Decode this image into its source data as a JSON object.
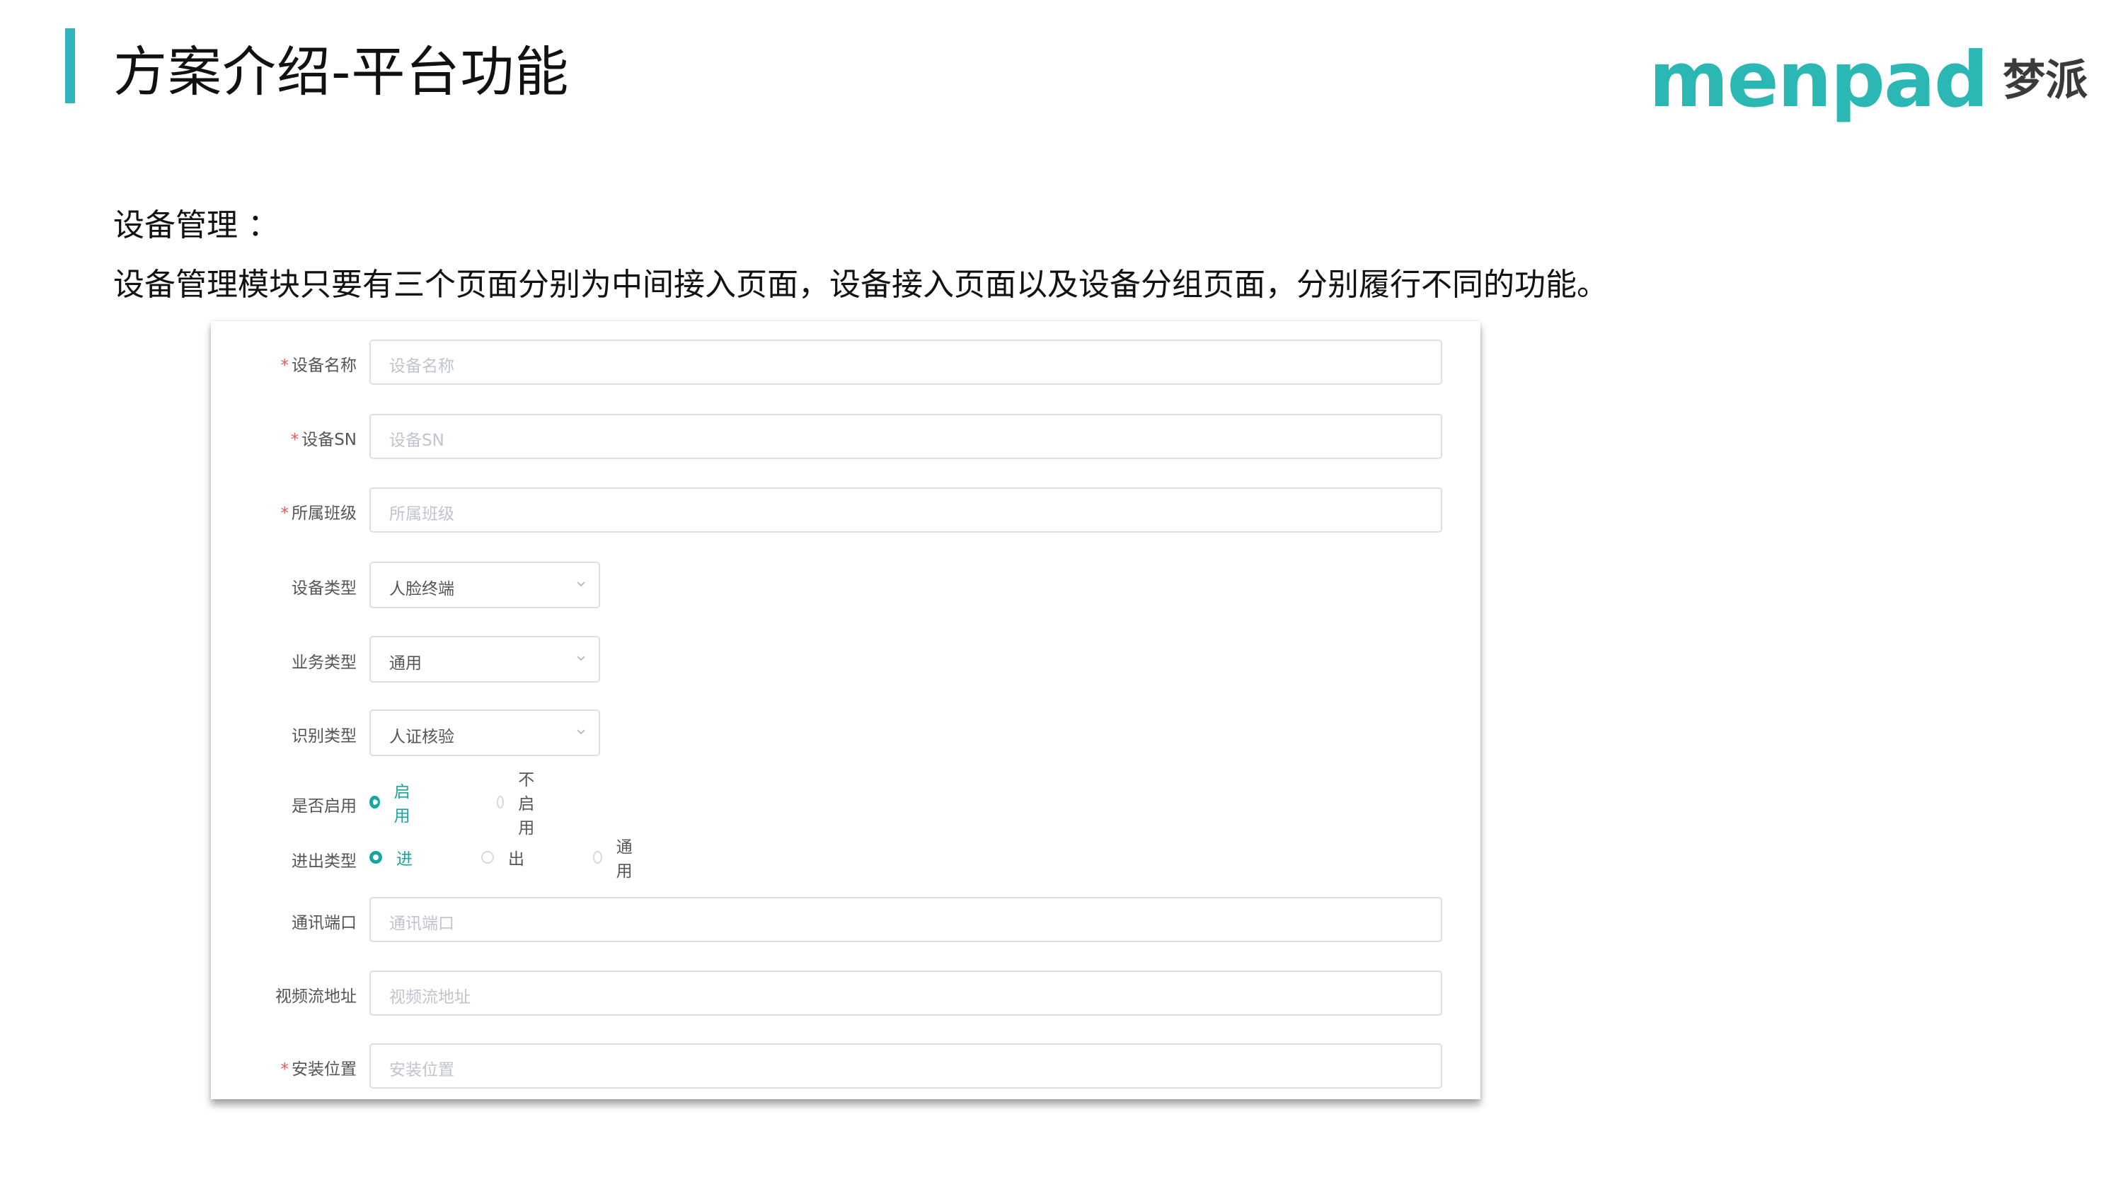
{
  "header": {
    "title": "方案介绍-平台功能",
    "logo_text": "menpad",
    "logo_cn": "梦派",
    "accent_color": "#2fb4bd"
  },
  "section": {
    "label": "设备管理 ：",
    "description": "设备管理模块只要有三个页面分别为中间接入页面，设备接入页面以及设备分组页面，分别履行不同的功能。"
  },
  "form": {
    "device_name": {
      "label": "设备名称",
      "required": true,
      "placeholder": "设备名称"
    },
    "device_sn": {
      "label": "设备SN",
      "required": true,
      "placeholder": "设备SN"
    },
    "class": {
      "label": "所属班级",
      "required": true,
      "placeholder": "所属班级"
    },
    "device_type": {
      "label": "设备类型",
      "value": "人脸终端"
    },
    "business_type": {
      "label": "业务类型",
      "value": "通用"
    },
    "recognition_type": {
      "label": "识别类型",
      "value": "人证核验"
    },
    "enabled": {
      "label": "是否启用",
      "options": [
        "启用",
        "不启用"
      ],
      "selected": "启用"
    },
    "direction": {
      "label": "进出类型",
      "options": [
        "进",
        "出",
        "通用"
      ],
      "selected": "进"
    },
    "port": {
      "label": "通讯端口",
      "placeholder": "通讯端口"
    },
    "stream_url": {
      "label": "视频流地址",
      "placeholder": "视频流地址"
    },
    "location": {
      "label": "安装位置",
      "required": true,
      "placeholder": "安装位置"
    },
    "required_mark": "*",
    "radio_color": "#1aa6a0"
  }
}
